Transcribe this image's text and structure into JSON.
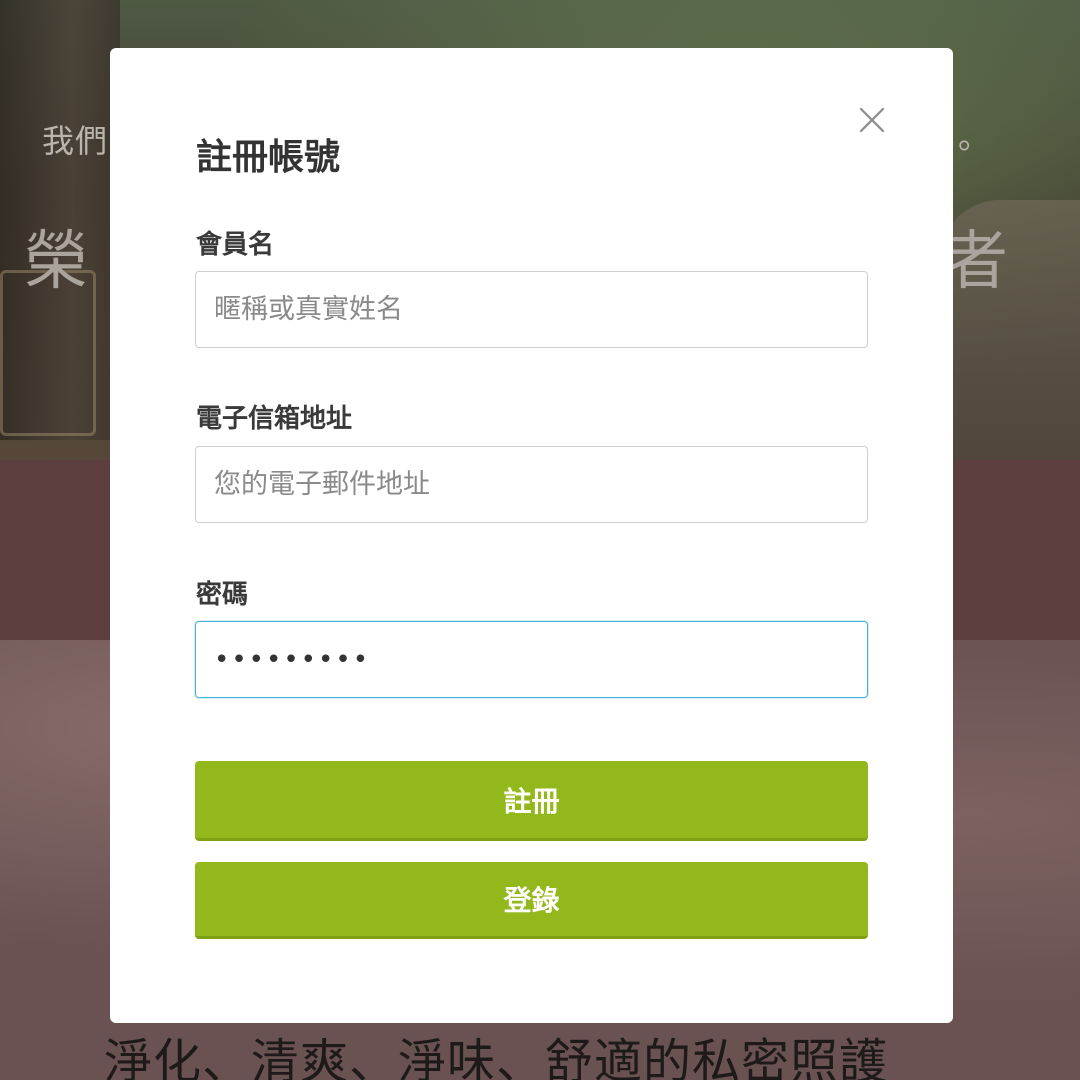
{
  "background": {
    "line_small_left": "我們",
    "line_small_right": "。",
    "line_large_left": "榮",
    "line_large_right": "者",
    "slogan": "淨化、清爽、淨味、舒適的私密照護"
  },
  "modal": {
    "title": "註冊帳號",
    "close_icon": "close-icon",
    "fields": {
      "username": {
        "label": "會員名",
        "placeholder": "暱稱或真實姓名",
        "value": ""
      },
      "email": {
        "label": "電子信箱地址",
        "placeholder": "您的電子郵件地址",
        "value": ""
      },
      "password": {
        "label": "密碼",
        "placeholder": "",
        "value": "•••••••••"
      }
    },
    "register_label": "註冊",
    "login_label": "登錄"
  },
  "colors": {
    "button_green": "#93b81b",
    "focus_border": "#4cb3d4",
    "overlay_band": "#5e3f40"
  }
}
